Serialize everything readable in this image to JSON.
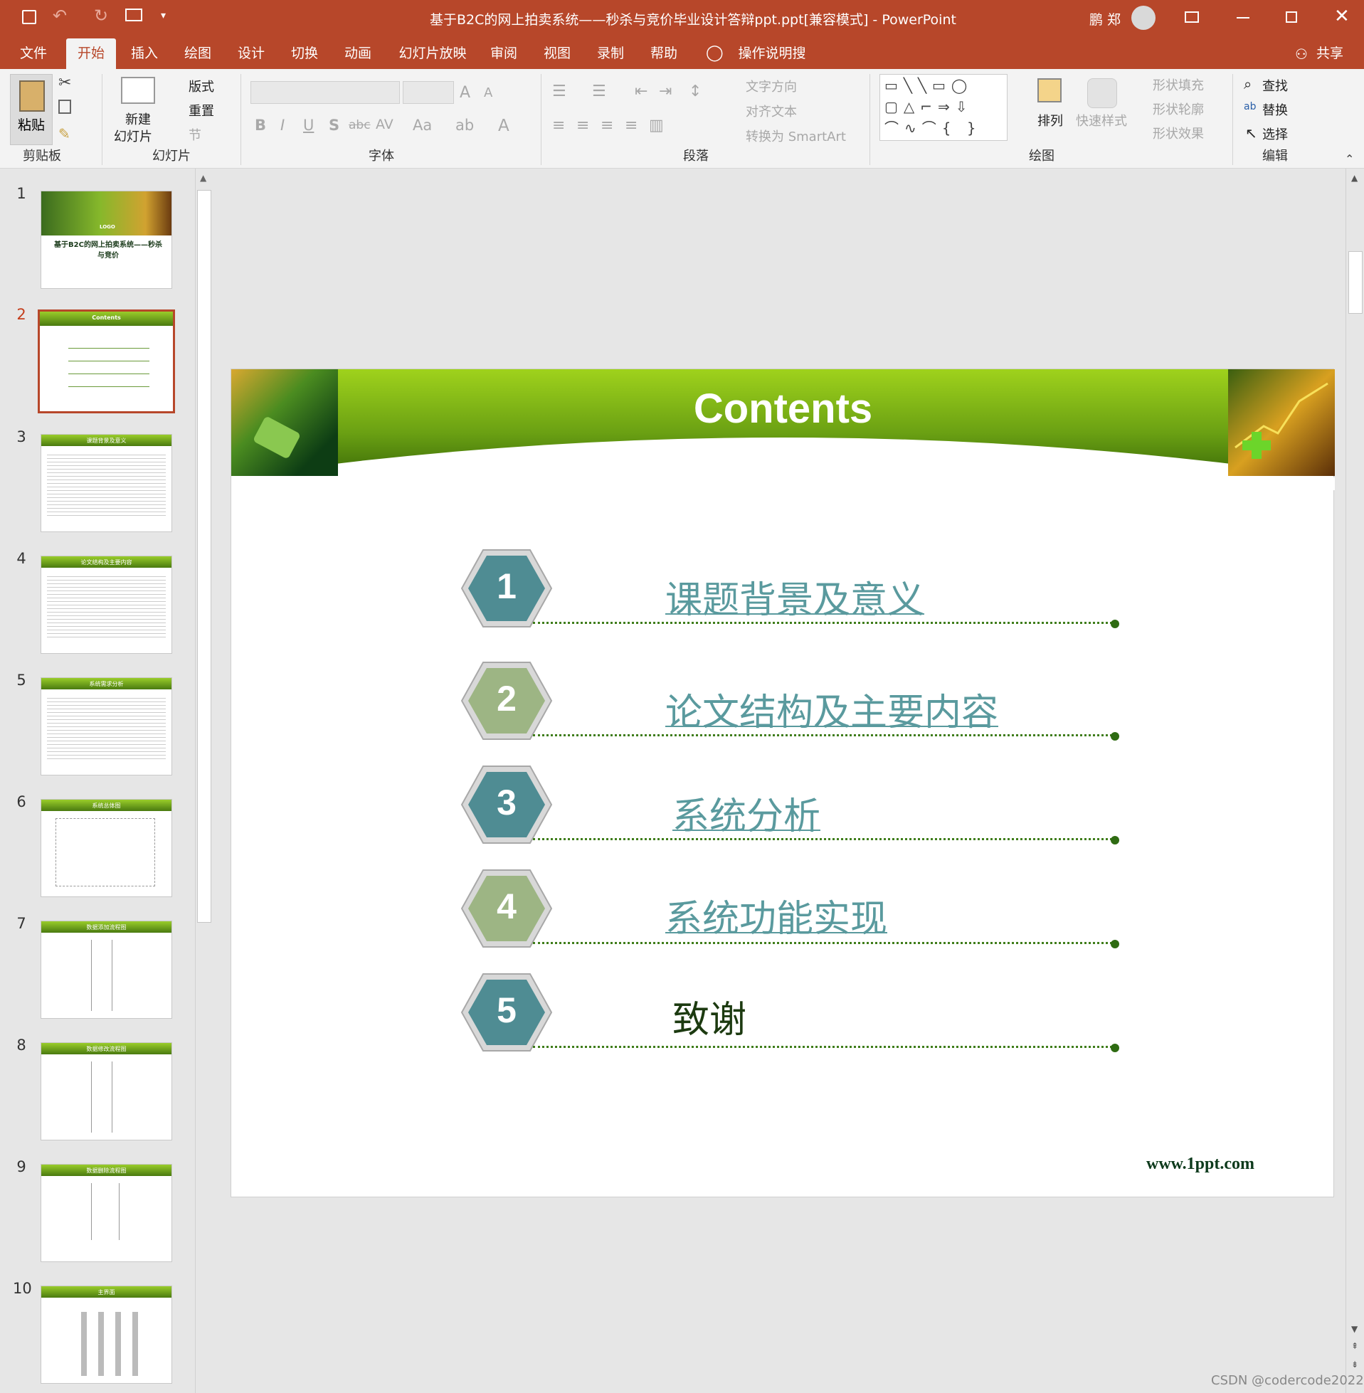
{
  "window": {
    "title": "基于B2C的网上拍卖系统——秒杀与竞价毕业设计答辩ppt.ppt[兼容模式]  -  PowerPoint",
    "user": "鹏 郑",
    "accent": "#b7472a"
  },
  "tabs": [
    "文件",
    "开始",
    "插入",
    "绘图",
    "设计",
    "切换",
    "动画",
    "幻灯片放映",
    "审阅",
    "视图",
    "录制",
    "帮助"
  ],
  "active_tab": "开始",
  "search_label": "操作说明搜索",
  "share_label": "共享",
  "ribbon": {
    "paste": "粘贴",
    "new_slide": "新建",
    "new_slide_2": "幻灯片",
    "layout": "版式",
    "reset": "重置",
    "section": "节",
    "text_direction": "文字方向",
    "align_text": "对齐文本",
    "convert_smartart": "转换为 SmartArt",
    "arrange": "排列",
    "quick_styles": "快速样式",
    "shape_fill": "形状填充",
    "shape_outline": "形状轮廓",
    "shape_effects": "形状效果",
    "find": "查找",
    "replace": "替换",
    "select": "选择",
    "groups": [
      "剪贴板",
      "幻灯片",
      "字体",
      "段落",
      "绘图",
      "编辑"
    ]
  },
  "thumbnails": [
    {
      "num": "1",
      "title": "基于B2C的网上拍卖系统——秒杀与竞价",
      "logo": "LOGO"
    },
    {
      "num": "2",
      "title": "Contents"
    },
    {
      "num": "3",
      "title": "课题背景及意义"
    },
    {
      "num": "4",
      "title": "论文结构及主要内容"
    },
    {
      "num": "5",
      "title": "系统需求分析"
    },
    {
      "num": "6",
      "title": "系统总体图"
    },
    {
      "num": "7",
      "title": "数据添加流程图"
    },
    {
      "num": "8",
      "title": "数据修改流程图"
    },
    {
      "num": "9",
      "title": "数据删除流程图"
    },
    {
      "num": "10",
      "title": "主界面"
    }
  ],
  "selected_slide": "2",
  "slide": {
    "title": "Contents",
    "items": [
      {
        "num": "1",
        "text": "课题背景及意义",
        "link": true
      },
      {
        "num": "2",
        "text": "论文结构及主要内容",
        "link": true
      },
      {
        "num": "3",
        "text": "系统分析",
        "link": true
      },
      {
        "num": "4",
        "text": "系统功能实现",
        "link": true
      },
      {
        "num": "5",
        "text": "致谢",
        "link": false
      }
    ],
    "footer": "www.1ppt.com"
  },
  "watermark": "CSDN @codercode2022"
}
